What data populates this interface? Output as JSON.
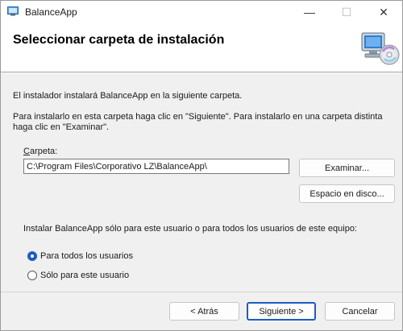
{
  "window": {
    "title": "BalanceApp",
    "controls": {
      "minimize": "—",
      "maximize": "☐",
      "close": "✕"
    }
  },
  "header": {
    "title": "Seleccionar carpeta de instalación",
    "icon": "computer-cd-icon"
  },
  "body": {
    "intro": "El instalador instalará BalanceApp en la siguiente carpeta.",
    "instructions": "Para instalarlo en esta carpeta haga clic en \"Siguiente\". Para instalarlo en una carpeta distinta haga clic en \"Examinar\".",
    "folder_label_accel": "C",
    "folder_label_rest": "arpeta:",
    "folder_path": "C:\\Program Files\\Corporativo LZ\\BalanceApp\\",
    "browse_button": "Examinar...",
    "disk_space_button": "Espacio en disco...",
    "install_for_question": "Instalar BalanceApp sólo para este usuario o para todos los usuarios de este equipo:",
    "options": [
      {
        "label": "Para todos los usuarios",
        "selected": true
      },
      {
        "label": "Sólo para este usuario",
        "selected": false
      }
    ]
  },
  "footer": {
    "back_button": "< Atrás",
    "next_button": "Siguiente >",
    "cancel_button": "Cancelar"
  },
  "colors": {
    "accent": "#1b5dbe",
    "background": "#f0f0f0",
    "header_background": "#ffffff"
  }
}
